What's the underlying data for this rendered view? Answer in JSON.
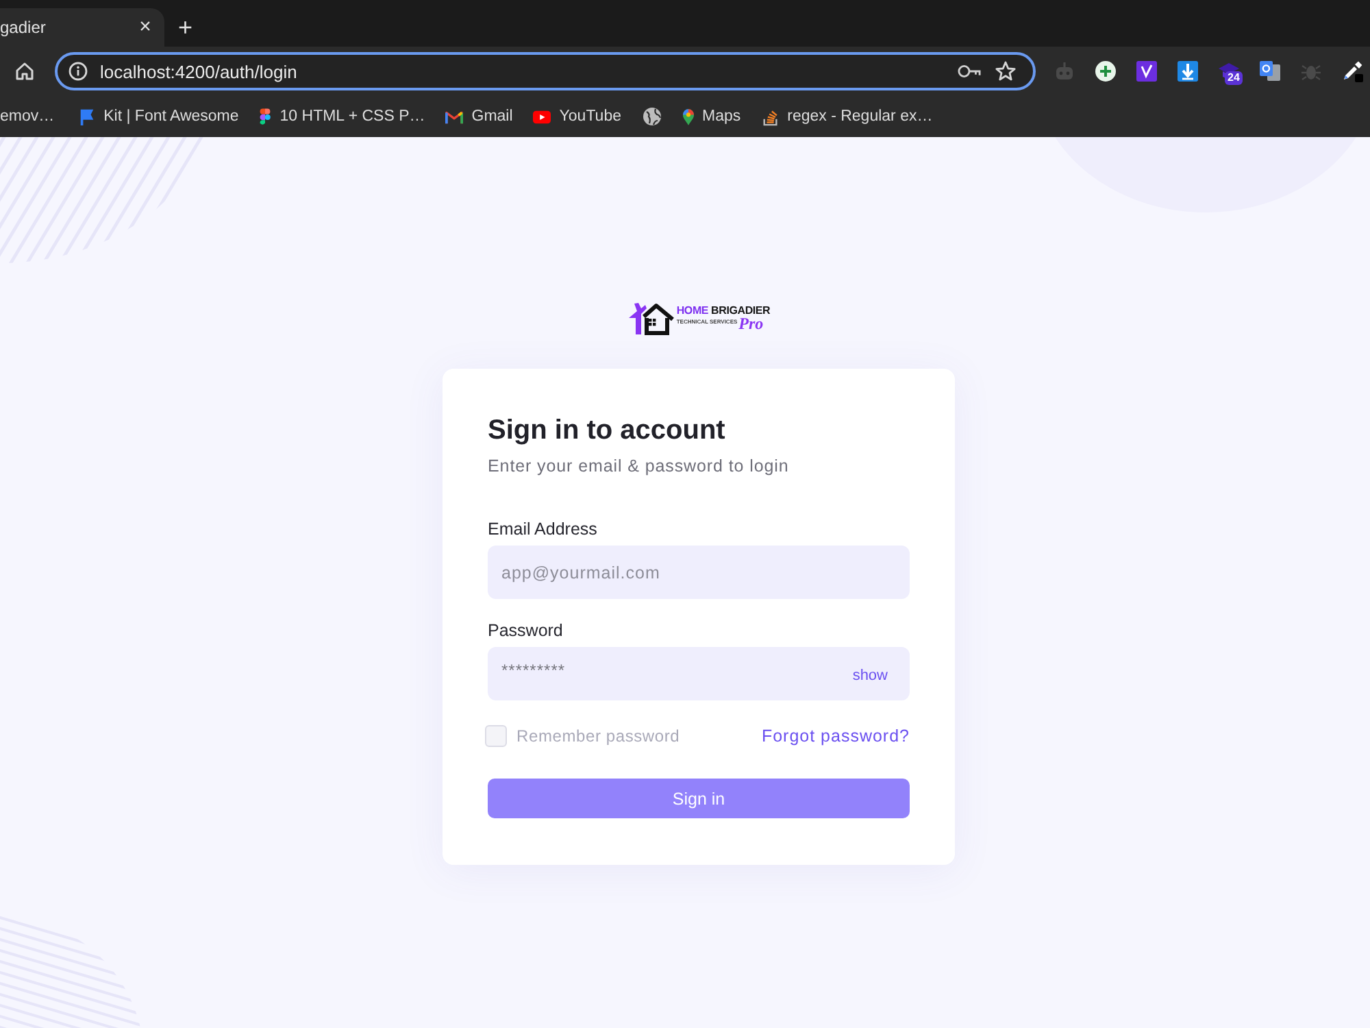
{
  "browser": {
    "tab": {
      "title": "gadier",
      "close": "×"
    },
    "new_tab": "+",
    "address": "localhost:4200/auth/login",
    "extension_badge": "24",
    "bookmarks": [
      {
        "label": "emov…"
      },
      {
        "label": "Kit | Font Awesome"
      },
      {
        "label": "10 HTML + CSS P…"
      },
      {
        "label": "Gmail"
      },
      {
        "label": "YouTube"
      },
      {
        "label": "Maps"
      },
      {
        "label": "regex - Regular ex…"
      }
    ]
  },
  "logo": {
    "name_first": "HOME",
    "name_second": "BRIGADIER",
    "tagline": "TECHNICAL SERVICES",
    "script": "Pro"
  },
  "login": {
    "title": "Sign in to account",
    "subtitle": "Enter your email & password to login",
    "email": {
      "label": "Email Address",
      "placeholder": "app@yourmail.com"
    },
    "password": {
      "label": "Password",
      "value": "*********",
      "toggle": "show"
    },
    "remember": {
      "label": "Remember password",
      "checked": false
    },
    "forgot_link": "Forgot password?",
    "submit": "Sign in"
  }
}
